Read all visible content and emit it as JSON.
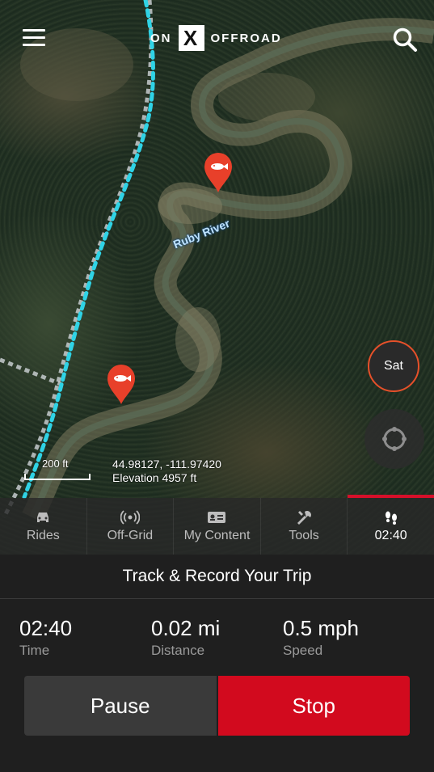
{
  "header": {
    "logo_on": "ON",
    "logo_mark": "X",
    "logo_offroad": "OFFROAD"
  },
  "map": {
    "river_label": "Ruby River",
    "scale_label": "200 ft",
    "coordinates": "44.98127, -111.97420",
    "elevation": "Elevation 4957 ft",
    "layer_button": "Sat",
    "pin_color": "#e8402a",
    "trail_color": "#2fd3e6"
  },
  "tabs": [
    {
      "label": "Rides",
      "icon": "car-icon"
    },
    {
      "label": "Off-Grid",
      "icon": "signal-icon"
    },
    {
      "label": "My Content",
      "icon": "id-card-icon"
    },
    {
      "label": "Tools",
      "icon": "tools-icon"
    },
    {
      "label": "02:40",
      "icon": "footprints-icon"
    }
  ],
  "tracker": {
    "title": "Track & Record Your Trip",
    "stats": [
      {
        "value": "02:40",
        "label": "Time"
      },
      {
        "value": "0.02 mi",
        "label": "Distance"
      },
      {
        "value": "0.5 mph",
        "label": "Speed"
      }
    ],
    "pause_label": "Pause",
    "stop_label": "Stop",
    "accent": "#d20a1e"
  }
}
